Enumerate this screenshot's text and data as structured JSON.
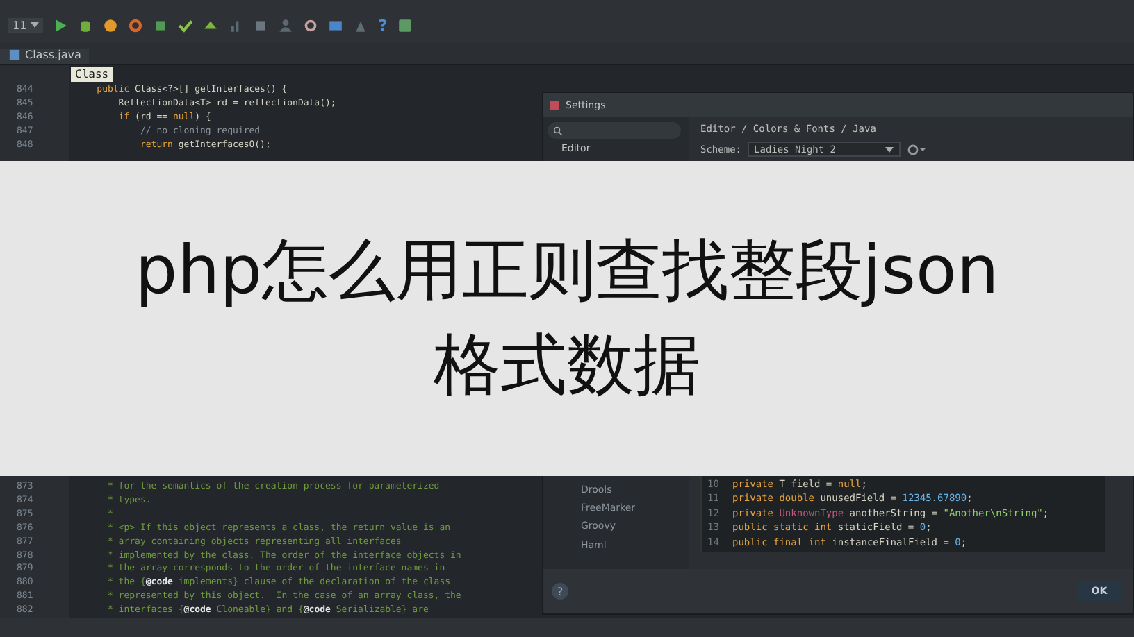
{
  "toolbar": {
    "config_dropdown": "11",
    "help_glyph": "?"
  },
  "tabs": [
    {
      "label": "Class.java",
      "selected": true
    }
  ],
  "tooltip": "Class",
  "editor": {
    "lines_top": [
      {
        "number": "844",
        "tokens": [
          {
            "text": "    public ",
            "kind": "keyword"
          },
          {
            "text": "Class<?>[] getInterfaces() {",
            "kind": "plain"
          }
        ]
      },
      {
        "number": "845",
        "tokens": [
          {
            "text": "        ReflectionData<T> rd = reflectionData();",
            "kind": "plain"
          }
        ]
      },
      {
        "number": "846",
        "tokens": [
          {
            "text": "        if ",
            "kind": "keyword"
          },
          {
            "text": "(rd == ",
            "kind": "plain"
          },
          {
            "text": "null",
            "kind": "keyword"
          },
          {
            "text": ") {",
            "kind": "plain"
          }
        ]
      },
      {
        "number": "847",
        "tokens": [
          {
            "text": "            // no cloning required",
            "kind": "comment"
          }
        ]
      },
      {
        "number": "848",
        "tokens": [
          {
            "text": "            return ",
            "kind": "keyword"
          },
          {
            "text": "getInterfaces0();",
            "kind": "plain"
          }
        ]
      }
    ],
    "lines_bottom": [
      {
        "number": "873",
        "tokens": [
          {
            "text": "      * for the semantics of the creation process for parameterized",
            "kind": "doc"
          }
        ]
      },
      {
        "number": "874",
        "tokens": [
          {
            "text": "      * types.",
            "kind": "doc"
          }
        ]
      },
      {
        "number": "875",
        "tokens": [
          {
            "text": "      *",
            "kind": "doc"
          }
        ]
      },
      {
        "number": "876",
        "tokens": [
          {
            "text": "      * <p> If this object represents a class, the return value is an",
            "kind": "doc"
          }
        ]
      },
      {
        "number": "877",
        "tokens": [
          {
            "text": "      * array containing objects representing all interfaces",
            "kind": "doc"
          }
        ]
      },
      {
        "number": "878",
        "tokens": [
          {
            "text": "      * implemented by the class. The order of the interface objects in",
            "kind": "doc"
          }
        ]
      },
      {
        "number": "879",
        "tokens": [
          {
            "text": "      * the array corresponds to the order of the interface names in",
            "kind": "doc"
          }
        ]
      },
      {
        "number": "880",
        "tokens": [
          {
            "text": "      * the {",
            "kind": "doc"
          },
          {
            "text": "@code",
            "kind": "tag"
          },
          {
            "text": " implements} clause of the declaration of the class",
            "kind": "doc"
          }
        ]
      },
      {
        "number": "881",
        "tokens": [
          {
            "text": "      * represented by this object.  In the case of an array class, the",
            "kind": "doc"
          }
        ]
      },
      {
        "number": "882",
        "tokens": [
          {
            "text": "      * interfaces {",
            "kind": "doc"
          },
          {
            "text": "@code",
            "kind": "tag"
          },
          {
            "text": " Cloneable} and {",
            "kind": "doc"
          },
          {
            "text": "@code",
            "kind": "tag"
          },
          {
            "text": " Serializable} are",
            "kind": "doc"
          }
        ]
      }
    ]
  },
  "banner": {
    "title": "php怎么用正则查找整段json格式数据"
  },
  "settings": {
    "title": "Settings",
    "breadcrumb": "Editor / Colors & Fonts / Java",
    "scheme_label": "Scheme:",
    "scheme_value": "Ladies Night 2",
    "sidebar_top": [
      {
        "label": "Editor",
        "selected": false
      }
    ],
    "sidebar_bottom": [
      {
        "label": "Drools",
        "selected": false
      },
      {
        "label": "FreeMarker",
        "selected": false
      },
      {
        "label": "Groovy",
        "selected": false
      },
      {
        "label": "Haml",
        "selected": false
      }
    ],
    "preview_lines": [
      {
        "number": "10",
        "tokens": [
          {
            "text": "private ",
            "kind": "keyword"
          },
          {
            "text": "T field = ",
            "kind": "plain"
          },
          {
            "text": "null",
            "kind": "keyword"
          },
          {
            "text": ";",
            "kind": "plain"
          }
        ]
      },
      {
        "number": "11",
        "tokens": [
          {
            "text": "private double ",
            "kind": "keyword"
          },
          {
            "text": "unusedField = ",
            "kind": "plain"
          },
          {
            "text": "12345.67890",
            "kind": "number"
          },
          {
            "text": ";",
            "kind": "plain"
          }
        ]
      },
      {
        "number": "12",
        "tokens": [
          {
            "text": "private ",
            "kind": "keyword"
          },
          {
            "text": "UnknownType ",
            "kind": "error"
          },
          {
            "text": "anotherString = ",
            "kind": "plain"
          },
          {
            "text": "\"Another\\nString\"",
            "kind": "string"
          },
          {
            "text": ";",
            "kind": "plain"
          }
        ]
      },
      {
        "number": "13",
        "tokens": [
          {
            "text": "public static int ",
            "kind": "keyword"
          },
          {
            "text": "staticField = ",
            "kind": "plain"
          },
          {
            "text": "0",
            "kind": "number"
          },
          {
            "text": ";",
            "kind": "plain"
          }
        ]
      },
      {
        "number": "14",
        "tokens": [
          {
            "text": "public final int ",
            "kind": "keyword"
          },
          {
            "text": "instanceFinalField = ",
            "kind": "plain"
          },
          {
            "text": "0",
            "kind": "number"
          },
          {
            "text": ";",
            "kind": "plain"
          }
        ]
      }
    ],
    "help_button": "?",
    "ok_button": "OK"
  }
}
